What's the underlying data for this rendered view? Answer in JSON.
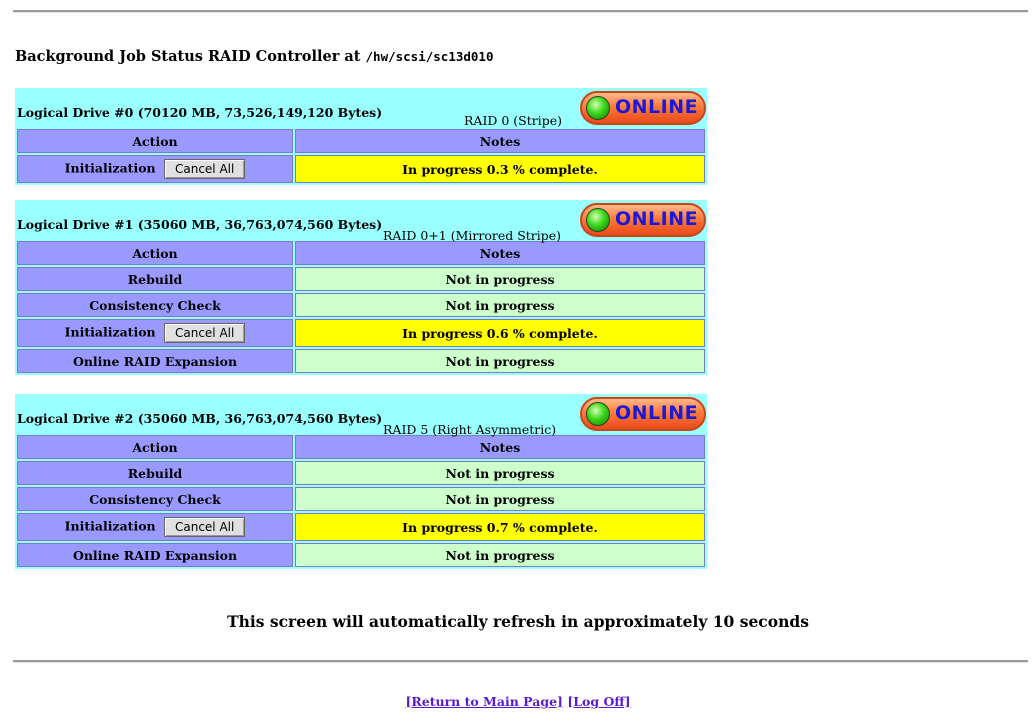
{
  "heading": {
    "text": "Background Job Status RAID Controller at ",
    "path": "/hw/scsi/sc13d010"
  },
  "columns": {
    "action": "Action",
    "notes": "Notes"
  },
  "cancel_label": "Cancel All",
  "online_label": "ONLINE",
  "drives": [
    {
      "label": "Logical Drive #0 (70120 MB, 73,526,149,120 Bytes)",
      "raid": "RAID 0 (Stripe)",
      "rows": [
        {
          "action": "Initialization",
          "note": "In progress 0.3 % complete."
        }
      ]
    },
    {
      "label": "Logical Drive #1 (35060 MB, 36,763,074,560 Bytes)",
      "raid": "RAID 0+1 (Mirrored Stripe)",
      "rows": [
        {
          "action": "Rebuild",
          "note": "Not in progress"
        },
        {
          "action": "Consistency Check",
          "note": "Not in progress"
        },
        {
          "action": "Initialization",
          "note": "In progress 0.6 % complete."
        },
        {
          "action": "Online RAID Expansion",
          "note": "Not in progress"
        }
      ]
    },
    {
      "label": "Logical Drive #2 (35060 MB, 36,763,074,560 Bytes)",
      "raid": "RAID 5 (Right Asymmetric)",
      "rows": [
        {
          "action": "Rebuild",
          "note": "Not in progress"
        },
        {
          "action": "Consistency Check",
          "note": "Not in progress"
        },
        {
          "action": "Initialization",
          "note": "In progress 0.7 % complete."
        },
        {
          "action": "Online RAID Expansion",
          "note": "Not in progress"
        }
      ]
    }
  ],
  "refresh_note": "This screen will automatically refresh in approximately 10 seconds",
  "links": {
    "main": "[Return to Main Page]",
    "logoff": "[Log Off]"
  }
}
